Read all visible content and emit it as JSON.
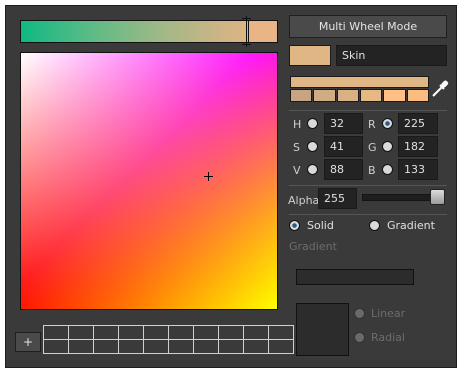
{
  "hue_bar": {
    "gradient_start": "#10b884",
    "gradient_end": "#e6b482",
    "current": "#e9b587"
  },
  "mode_button": {
    "label": "Multi Wheel Mode"
  },
  "current_swatch": {
    "color": "#e1b685",
    "name": "Skin"
  },
  "palette": {
    "main_color": "#e1b685",
    "colors": [
      "#c7a583",
      "#d1ab84",
      "#dbb085",
      "#e6b886",
      "#ffbf85",
      "#fbbc7f"
    ]
  },
  "eyedropper": {
    "icon": "eyedropper-icon"
  },
  "hsv": {
    "h": {
      "label": "H",
      "value": "32"
    },
    "s": {
      "label": "S",
      "value": "41"
    },
    "v": {
      "label": "V",
      "value": "88"
    }
  },
  "rgb": {
    "r": {
      "label": "R",
      "value": "225",
      "selected": true
    },
    "g": {
      "label": "G",
      "value": "182"
    },
    "b": {
      "label": "B",
      "value": "133"
    }
  },
  "alpha": {
    "label": "Alpha",
    "value": "255",
    "level": 1.0
  },
  "fill_type": {
    "solid_label": "Solid",
    "gradient_label": "Gradient",
    "selected": "Solid"
  },
  "gradient_section": {
    "title": "Gradient",
    "linear_label": "Linear",
    "radial_label": "Radial"
  },
  "add_button": {
    "label": "+"
  },
  "swatch_grid": {
    "rows": 2,
    "cols": 10
  }
}
